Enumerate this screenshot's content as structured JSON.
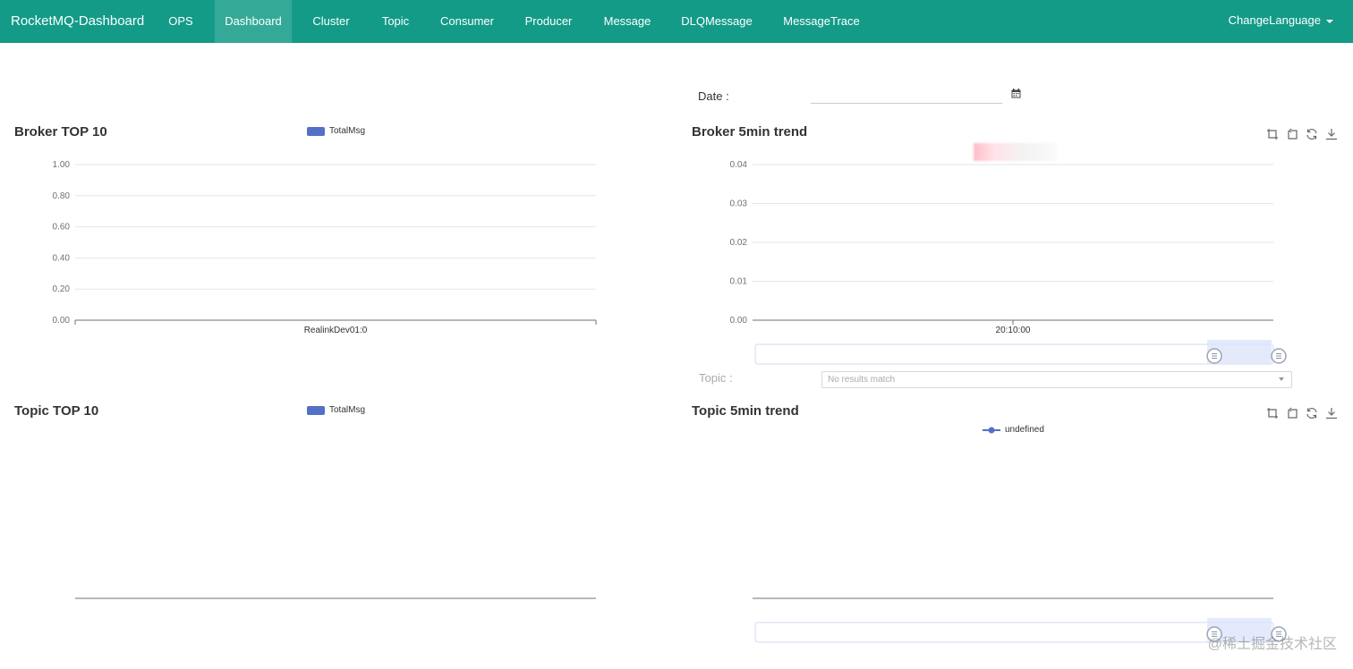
{
  "navbar": {
    "brand": "RocketMQ-Dashboard",
    "items": [
      {
        "label": "OPS",
        "active": false
      },
      {
        "label": "Dashboard",
        "active": true
      },
      {
        "label": "Cluster",
        "active": false
      },
      {
        "label": "Topic",
        "active": false
      },
      {
        "label": "Consumer",
        "active": false
      },
      {
        "label": "Producer",
        "active": false
      },
      {
        "label": "Message",
        "active": false
      },
      {
        "label": "DLQMessage",
        "active": false
      },
      {
        "label": "MessageTrace",
        "active": false
      }
    ],
    "language": "ChangeLanguage",
    "background_color": "#139b88"
  },
  "date_filter": {
    "label": "Date :",
    "value": ""
  },
  "topic_filter": {
    "label": "Topic :",
    "placeholder": "No results match"
  },
  "broker_top10": {
    "title": "Broker TOP 10",
    "legend": "TotalMsg"
  },
  "broker_trend": {
    "title": "Broker 5min trend"
  },
  "topic_top10": {
    "title": "Topic TOP 10",
    "legend": "TotalMsg"
  },
  "topic_trend": {
    "title": "Topic 5min trend",
    "legend": "undefined"
  },
  "watermark": "@稀土掘金技术社区",
  "colors": {
    "series": "#5470c6",
    "axis": "#6e7079",
    "grid": "#e0e6f1",
    "zoom_fill": "#dbe3fb"
  },
  "chart_data": [
    {
      "type": "bar",
      "title": "Broker TOP 10",
      "legend": [
        "TotalMsg"
      ],
      "categories": [
        "RealinkDev01:0"
      ],
      "series": [
        {
          "name": "TotalMsg",
          "values": [
            0
          ]
        }
      ],
      "ylim": [
        0,
        1
      ],
      "yticks": [
        "0.00",
        "0.20",
        "0.40",
        "0.60",
        "0.80",
        "1.00"
      ],
      "grid": true
    },
    {
      "type": "line",
      "title": "Broker 5min trend",
      "x": [
        "20:10:00"
      ],
      "series": [],
      "ylim": [
        0,
        0.04
      ],
      "yticks": [
        "0.00",
        "0.01",
        "0.02",
        "0.03",
        "0.04"
      ],
      "grid": true,
      "data_zoom": [
        0.9,
        1.0
      ]
    },
    {
      "type": "bar",
      "title": "Topic TOP 10",
      "legend": [
        "TotalMsg"
      ],
      "categories": [],
      "series": [
        {
          "name": "TotalMsg",
          "values": []
        }
      ]
    },
    {
      "type": "line",
      "title": "Topic 5min trend",
      "legend": [
        "undefined"
      ],
      "x": [],
      "series": [
        {
          "name": "undefined",
          "values": []
        }
      ],
      "data_zoom": [
        0.9,
        1.0
      ]
    }
  ]
}
